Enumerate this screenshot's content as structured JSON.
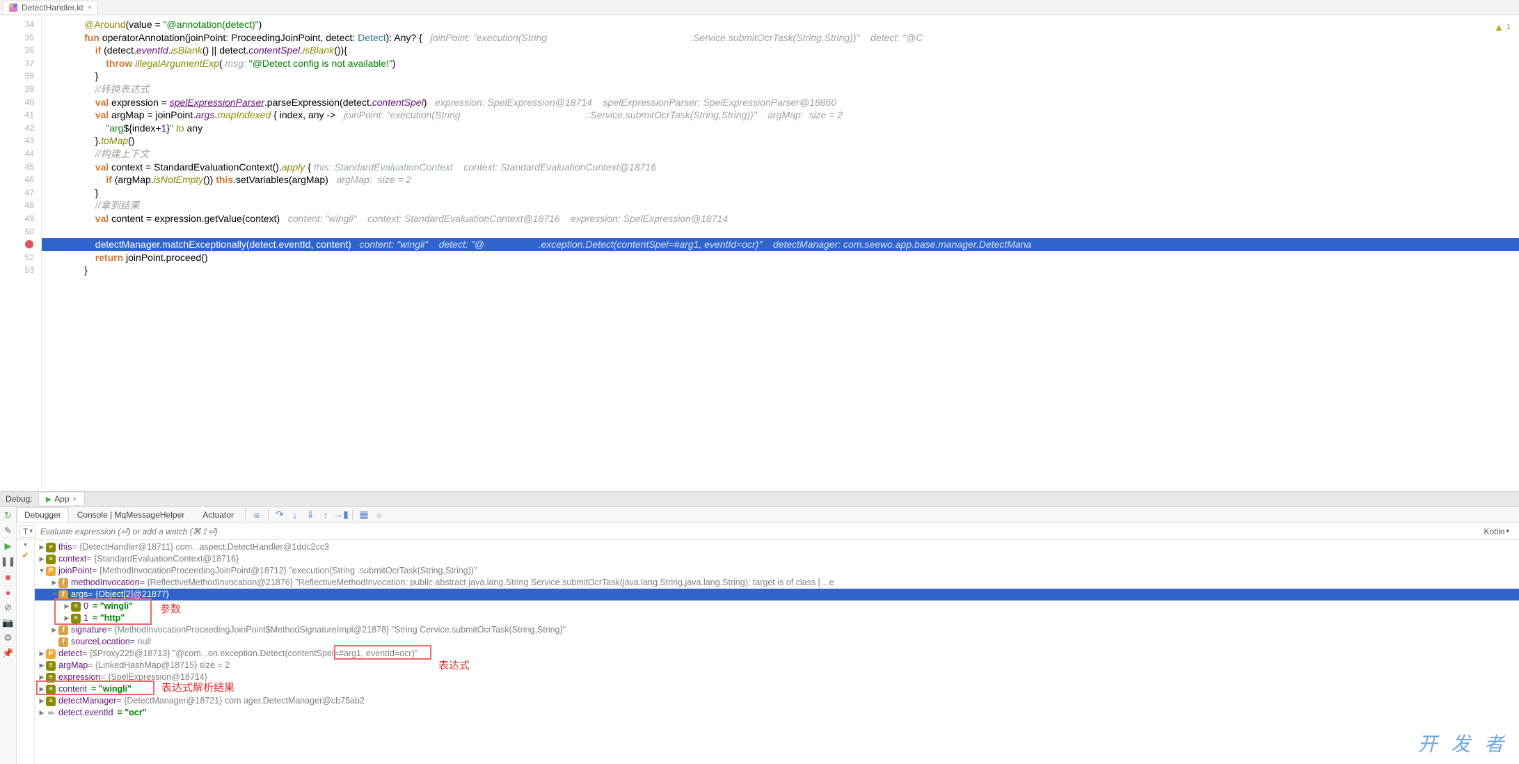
{
  "tab": {
    "file_name": "DetectHandler.kt"
  },
  "editor": {
    "first_line": 34,
    "breakpoint_line": 51,
    "lines": [
      {
        "n": 34,
        "seg": [
          {
            "t": "        ",
            "c": ""
          },
          {
            "t": "@Around",
            "c": "ann"
          },
          {
            "t": "(value = ",
            "c": ""
          },
          {
            "t": "\"@annotation(detect)\"",
            "c": "str"
          },
          {
            "t": ")",
            "c": ""
          }
        ]
      },
      {
        "n": 35,
        "seg": [
          {
            "t": "        ",
            "c": ""
          },
          {
            "t": "fun ",
            "c": "kw"
          },
          {
            "t": "operatorAnnotation",
            "c": ""
          },
          {
            "t": "(joinPoint: ProceedingJoinPoint, detect: ",
            "c": ""
          },
          {
            "t": "Detect",
            "c": "type"
          },
          {
            "t": "): Any? {   ",
            "c": ""
          },
          {
            "t": "joinPoint: \"execution(String                                                     :Service.submitOcrTask(String,String))\"    detect: \"@C",
            "c": "inline-hint"
          }
        ]
      },
      {
        "n": 36,
        "seg": [
          {
            "t": "            ",
            "c": ""
          },
          {
            "t": "if ",
            "c": "kw"
          },
          {
            "t": "(detect.",
            "c": ""
          },
          {
            "t": "eventId",
            "c": "prop-it"
          },
          {
            "t": ".",
            "c": ""
          },
          {
            "t": "isBlank",
            "c": "fn-it"
          },
          {
            "t": "() || detect.",
            "c": ""
          },
          {
            "t": "contentSpel",
            "c": "prop-it"
          },
          {
            "t": ".",
            "c": ""
          },
          {
            "t": "isBlank",
            "c": "fn-it"
          },
          {
            "t": "()){",
            "c": ""
          }
        ]
      },
      {
        "n": 37,
        "seg": [
          {
            "t": "                ",
            "c": ""
          },
          {
            "t": "throw ",
            "c": "kw"
          },
          {
            "t": "illegalArgumentExp",
            "c": "fn-it"
          },
          {
            "t": "( ",
            "c": ""
          },
          {
            "t": "msg: ",
            "c": "param-hint"
          },
          {
            "t": "\"@Detect config is not available!\"",
            "c": "str"
          },
          {
            "t": ")",
            "c": ""
          }
        ]
      },
      {
        "n": 38,
        "seg": [
          {
            "t": "            }",
            "c": ""
          }
        ]
      },
      {
        "n": 39,
        "seg": [
          {
            "t": "            ",
            "c": ""
          },
          {
            "t": "//转换表达式",
            "c": "inline-hint"
          }
        ]
      },
      {
        "n": 40,
        "seg": [
          {
            "t": "            ",
            "c": ""
          },
          {
            "t": "val ",
            "c": "kw"
          },
          {
            "t": "expression = ",
            "c": ""
          },
          {
            "t": "spelExpressionParser",
            "c": "prop-it ul"
          },
          {
            "t": ".parseExpression(detect.",
            "c": ""
          },
          {
            "t": "contentSpel",
            "c": "prop-it"
          },
          {
            "t": ")   ",
            "c": ""
          },
          {
            "t": "expression: SpelExpression@18714    spelExpressionParser: SpelExpressionParser@18860",
            "c": "inline-hint"
          }
        ]
      },
      {
        "n": 41,
        "seg": [
          {
            "t": "            ",
            "c": ""
          },
          {
            "t": "val ",
            "c": "kw"
          },
          {
            "t": "argMap = joinPoint.",
            "c": ""
          },
          {
            "t": "args",
            "c": "prop-it"
          },
          {
            "t": ".",
            "c": ""
          },
          {
            "t": "mapIndexed",
            "c": "fn-it"
          },
          {
            "t": " { index, any ->   ",
            "c": ""
          },
          {
            "t": "joinPoint: \"execution(String                                              .:Service.submitOcrTask(String,String))\"    argMap:  size = 2",
            "c": "inline-hint"
          }
        ]
      },
      {
        "n": 42,
        "seg": [
          {
            "t": "                ",
            "c": ""
          },
          {
            "t": "\"arg",
            "c": "str"
          },
          {
            "t": "${index+",
            "c": ""
          },
          {
            "t": "1",
            "c": "num"
          },
          {
            "t": "}",
            "c": ""
          },
          {
            "t": "\"",
            "c": "str"
          },
          {
            "t": " to ",
            "c": "fn-it"
          },
          {
            "t": "any",
            "c": ""
          }
        ]
      },
      {
        "n": 43,
        "seg": [
          {
            "t": "            }.",
            "c": ""
          },
          {
            "t": "toMap",
            "c": "fn-it"
          },
          {
            "t": "()",
            "c": ""
          }
        ]
      },
      {
        "n": 44,
        "seg": [
          {
            "t": "            ",
            "c": ""
          },
          {
            "t": "//构建上下文",
            "c": "inline-hint"
          }
        ]
      },
      {
        "n": 45,
        "seg": [
          {
            "t": "            ",
            "c": ""
          },
          {
            "t": "val ",
            "c": "kw"
          },
          {
            "t": "context = StandardEvaluationContext().",
            "c": ""
          },
          {
            "t": "apply",
            "c": "fn-it"
          },
          {
            "t": " { ",
            "c": ""
          },
          {
            "t": "this: StandardEvaluationContext",
            "c": "param-hint"
          },
          {
            "t": "    ",
            "c": ""
          },
          {
            "t": "context: StandardEvaluationContext@18716",
            "c": "inline-hint"
          }
        ]
      },
      {
        "n": 46,
        "seg": [
          {
            "t": "                ",
            "c": ""
          },
          {
            "t": "if ",
            "c": "kw"
          },
          {
            "t": "(argMap.",
            "c": ""
          },
          {
            "t": "isNotEmpty",
            "c": "fn-it"
          },
          {
            "t": "()) ",
            "c": ""
          },
          {
            "t": "this",
            "c": "kw"
          },
          {
            "t": ".setVariables(argMap)   ",
            "c": ""
          },
          {
            "t": "argMap:  size = 2",
            "c": "inline-hint"
          }
        ]
      },
      {
        "n": 47,
        "seg": [
          {
            "t": "            }",
            "c": ""
          }
        ]
      },
      {
        "n": 48,
        "seg": [
          {
            "t": "            ",
            "c": ""
          },
          {
            "t": "//拿到结果",
            "c": "inline-hint"
          }
        ]
      },
      {
        "n": 49,
        "seg": [
          {
            "t": "            ",
            "c": ""
          },
          {
            "t": "val ",
            "c": "kw"
          },
          {
            "t": "content = expression.getValue(context)   ",
            "c": ""
          },
          {
            "t": "content: \"wingli\"    context: StandardEvaluationContext@18716    expression: SpelExpression@18714",
            "c": "inline-hint"
          }
        ]
      },
      {
        "n": 50,
        "seg": [
          {
            "t": " ",
            "c": ""
          }
        ]
      },
      {
        "n": 51,
        "hl": true,
        "seg": [
          {
            "t": "            detectManager.matchExceptionally(detect.",
            "c": ""
          },
          {
            "t": "eventId",
            "c": ""
          },
          {
            "t": ", content)   ",
            "c": ""
          },
          {
            "t": "content: \"wingli\"    detect: \"@                    .exception.Detect(contentSpel=#arg1, eventId=ocr)\"    detectManager: com.seewo.app.base.manager.DetectMana",
            "c": "inline-hint"
          }
        ]
      },
      {
        "n": 52,
        "seg": [
          {
            "t": "            ",
            "c": ""
          },
          {
            "t": "return ",
            "c": "kw"
          },
          {
            "t": "joinPoint.proceed()",
            "c": ""
          }
        ]
      },
      {
        "n": 53,
        "seg": [
          {
            "t": "        }",
            "c": ""
          }
        ]
      }
    ],
    "warning_count": "1"
  },
  "debug": {
    "title": "Debug:",
    "run_config_name": "App",
    "tabs": {
      "debugger": "Debugger",
      "console": "Console | MqMessageHelper",
      "actuator": "Actuator"
    },
    "thread_button": "T",
    "expr_placeholder": "Evaluate expression (⏎) or add a watch (⌘⇧⏎)",
    "language_label": "Kotlin",
    "variables": [
      {
        "depth": 0,
        "tw": "▶",
        "badge": "e",
        "name": "this",
        "val_gray": " = {DetectHandler@18711} com.           .aspect.DetectHandler@1ddc2cc3"
      },
      {
        "depth": 0,
        "tw": "▶",
        "badge": "e",
        "name": "context",
        "val_gray": " = {StandardEvaluationContext@18716}"
      },
      {
        "depth": 0,
        "tw": "▼",
        "badge": "p",
        "name": "joinPoint",
        "val_gray": " = {MethodInvocationProceedingJoinPoint@18712} \"execution(String                                                              .submitOcrTask(String,String))\""
      },
      {
        "depth": 1,
        "tw": "▶",
        "badge": "f",
        "name": "methodInvocation",
        "val_gray": " = {ReflectiveMethodInvocation@21876} \"ReflectiveMethodInvocation: public abstract java.lang.String                                                     Service.submitOcrTask(java.lang.String,java.lang.String); target is of class [",
        "tail": "…e"
      },
      {
        "depth": 1,
        "tw": "▼",
        "badge": "f",
        "name": "args",
        "val_gray": " = {Object[2]@21877}",
        "sel": true
      },
      {
        "depth": 2,
        "tw": "▶",
        "badge": "e",
        "name": "0",
        "val_str": " = \"wingli\""
      },
      {
        "depth": 2,
        "tw": "▶",
        "badge": "e",
        "name": "1",
        "val_str": " = \"http\""
      },
      {
        "depth": 1,
        "tw": "▶",
        "badge": "f",
        "name": "signature",
        "val_gray": " = {MethodInvocationProceedingJoinPoint$MethodSignatureImpl@21878} \"String                                                     Cervice.submitOcrTask(String,String)\""
      },
      {
        "depth": 1,
        "tw": "",
        "badge": "f",
        "name": "sourceLocation",
        "val_gray": " = null"
      },
      {
        "depth": 0,
        "tw": "▶",
        "badge": "p",
        "name": "detect",
        "val_gray": " = {$Proxy225@18713} \"@com.            .on.exception.Detect(contentSpel=#arg1, eventId=ocr)\""
      },
      {
        "depth": 0,
        "tw": "▶",
        "badge": "e",
        "name": "argMap",
        "val_gray": " = {LinkedHashMap@18715}  size = 2"
      },
      {
        "depth": 0,
        "tw": "▶",
        "badge": "e",
        "name": "expression",
        "val_gray": " = {SpelExpression@18714}"
      },
      {
        "depth": 0,
        "tw": "▶",
        "badge": "e",
        "name": "content",
        "val_str": " = \"wingli\""
      },
      {
        "depth": 0,
        "tw": "▶",
        "badge": "e",
        "name": "detectManager",
        "val_gray": " = {DetectManager@18721} com                        ager.DetectManager@cb75ab2"
      },
      {
        "depth": 0,
        "tw": "▶",
        "badge": "link",
        "name": "detect.eventId",
        "val_str": " = \"ocr\""
      }
    ]
  },
  "callouts": {
    "args": "参数",
    "expr": "表达式",
    "result": "表达式解析结果"
  },
  "watermark": "开 发 者"
}
